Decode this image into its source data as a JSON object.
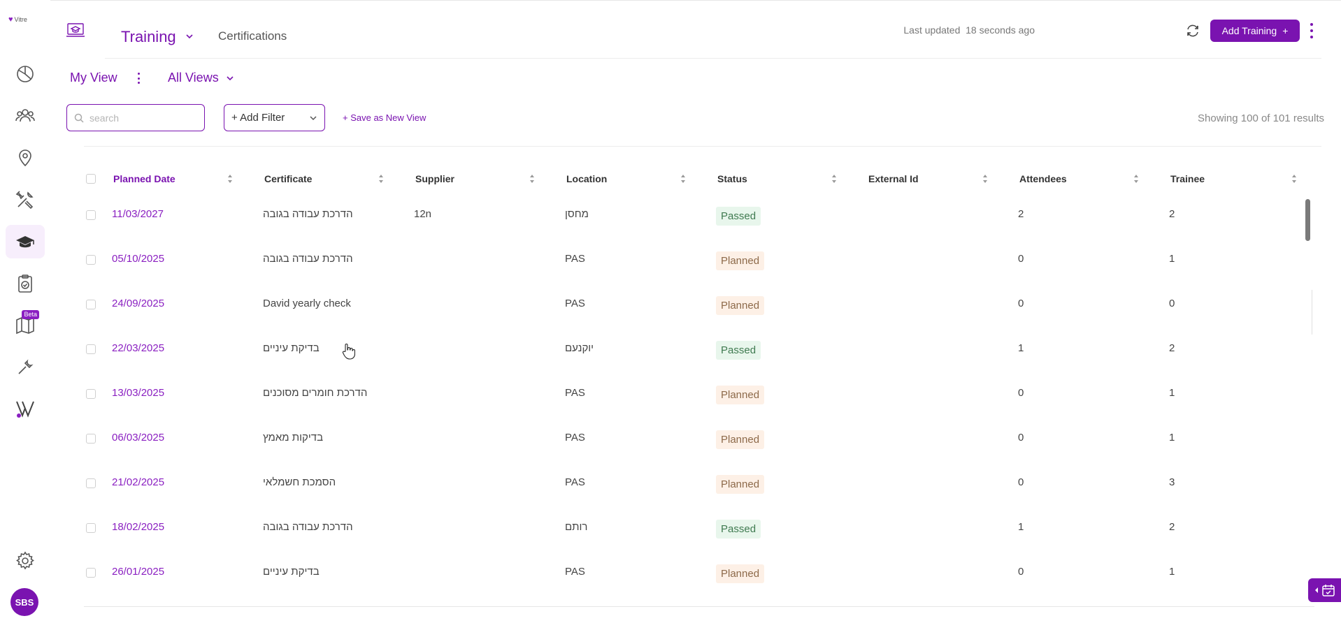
{
  "app": {
    "logo_text": "Vitre"
  },
  "sidebar": {
    "items": [
      {
        "name": "dashboard-icon"
      },
      {
        "name": "users-icon"
      },
      {
        "name": "location-pin-icon"
      },
      {
        "name": "tools-icon"
      },
      {
        "name": "graduation-cap-icon",
        "active": true
      },
      {
        "name": "clipboard-check-icon"
      },
      {
        "name": "map-icon",
        "badge": "Beta"
      },
      {
        "name": "wrench-icon"
      },
      {
        "name": "brand-v-icon"
      }
    ],
    "settings_icon": "gear-icon",
    "avatar": "SBS"
  },
  "header": {
    "title": "Training",
    "tab_certifications": "Certifications",
    "last_updated_label": "Last updated",
    "last_updated_value": "18 seconds ago",
    "add_training_label": "Add Training",
    "add_icon": "+"
  },
  "views": {
    "my_view": "My View",
    "all_views": "All Views"
  },
  "filters": {
    "search_placeholder": "search",
    "add_filter": "+ Add Filter",
    "save_view": "+ Save as New View",
    "showing": "Showing 100 of 101 results"
  },
  "table": {
    "columns": [
      "Planned Date",
      "Certificate",
      "Supplier",
      "Location",
      "Status",
      "External Id",
      "Attendees",
      "Trainee"
    ],
    "rows": [
      {
        "date": "11/03/2027",
        "certificate": "הדרכת עבודה בגובה",
        "supplier": "12n",
        "location": "מחסן",
        "status": "Passed",
        "external_id": "",
        "attendees": "2",
        "trainee": "2"
      },
      {
        "date": "05/10/2025",
        "certificate": "הדרכת עבודה בגובה",
        "supplier": "",
        "location": "PAS",
        "status": "Planned",
        "external_id": "",
        "attendees": "0",
        "trainee": "1"
      },
      {
        "date": "24/09/2025",
        "certificate": "David yearly check",
        "supplier": "",
        "location": "PAS",
        "status": "Planned",
        "external_id": "",
        "attendees": "0",
        "trainee": "0"
      },
      {
        "date": "22/03/2025",
        "certificate": "בדיקת עיניים",
        "supplier": "",
        "location": "יוקנעם",
        "status": "Passed",
        "external_id": "",
        "attendees": "1",
        "trainee": "2"
      },
      {
        "date": "13/03/2025",
        "certificate": "הדרכת חומרים מסוכנים",
        "supplier": "",
        "location": "PAS",
        "status": "Planned",
        "external_id": "",
        "attendees": "0",
        "trainee": "1"
      },
      {
        "date": "06/03/2025",
        "certificate": "בדיקות מאמץ",
        "supplier": "",
        "location": "PAS",
        "status": "Planned",
        "external_id": "",
        "attendees": "0",
        "trainee": "1"
      },
      {
        "date": "21/02/2025",
        "certificate": "הסמכת חשמלאי",
        "supplier": "",
        "location": "PAS",
        "status": "Planned",
        "external_id": "",
        "attendees": "0",
        "trainee": "3"
      },
      {
        "date": "18/02/2025",
        "certificate": "הדרכת עבודה בגובה",
        "supplier": "",
        "location": "רותם",
        "status": "Passed",
        "external_id": "",
        "attendees": "1",
        "trainee": "2"
      },
      {
        "date": "26/01/2025",
        "certificate": "בדיקת עיניים",
        "supplier": "",
        "location": "PAS",
        "status": "Planned",
        "external_id": "",
        "attendees": "0",
        "trainee": "1"
      }
    ]
  },
  "colors": {
    "accent": "#7a13b0",
    "passed_bg": "#e8f6ec",
    "planned_bg": "#fdf0e6"
  }
}
